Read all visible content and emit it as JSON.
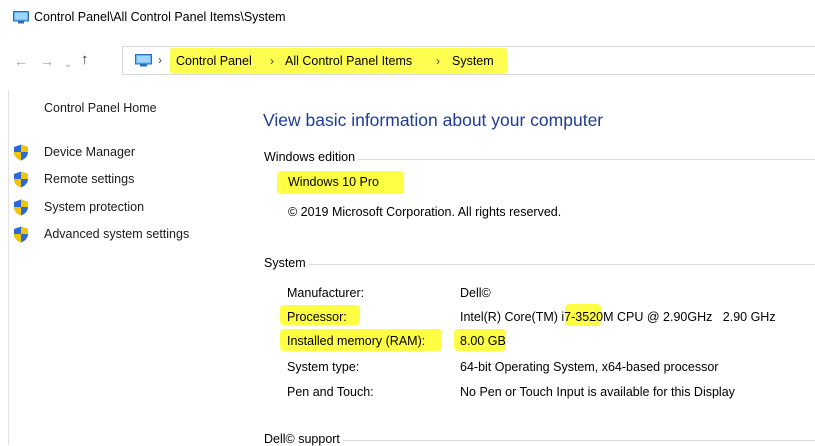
{
  "window": {
    "title": "Control Panel\\All Control Panel Items\\System"
  },
  "address_bar": {
    "breadcrumbs": [
      "Control Panel",
      "All Control Panel Items",
      "System"
    ],
    "separator": "›"
  },
  "left_pane": {
    "home_link": "Control Panel Home",
    "items": [
      {
        "label": "Device Manager",
        "icon": "shield-icon"
      },
      {
        "label": "Remote settings",
        "icon": "shield-icon"
      },
      {
        "label": "System protection",
        "icon": "shield-icon"
      },
      {
        "label": "Advanced system settings",
        "icon": "shield-icon"
      }
    ]
  },
  "main": {
    "heading": "View basic information about your computer",
    "windows_edition": {
      "section_title": "Windows edition",
      "edition": "Windows 10 Pro",
      "copyright": "© 2019 Microsoft Corporation. All rights reserved."
    },
    "system": {
      "section_title": "System",
      "rows": [
        {
          "label": "Manufacturer:",
          "value": "Dell©"
        },
        {
          "label": "Processor:",
          "value_prefix": "Intel(R) Core(TM) ",
          "value_highlight": "i7-3",
          "value_suffix": "520M CPU @ 2.90GHz   2.90 GHz"
        },
        {
          "label": "Installed memory (RAM):",
          "value": "8.00 GB"
        },
        {
          "label": "System type:",
          "value": "64-bit Operating System, x64-based processor"
        },
        {
          "label": "Pen and Touch:",
          "value": "No Pen or Touch Input is available for this Display"
        }
      ]
    },
    "support": {
      "section_title": "Dell© support"
    }
  },
  "colors": {
    "highlight": "#fefe44",
    "heading_blue": "#1e3c96",
    "shield_blue": "#2b6ad6",
    "shield_yellow": "#f3c400"
  }
}
